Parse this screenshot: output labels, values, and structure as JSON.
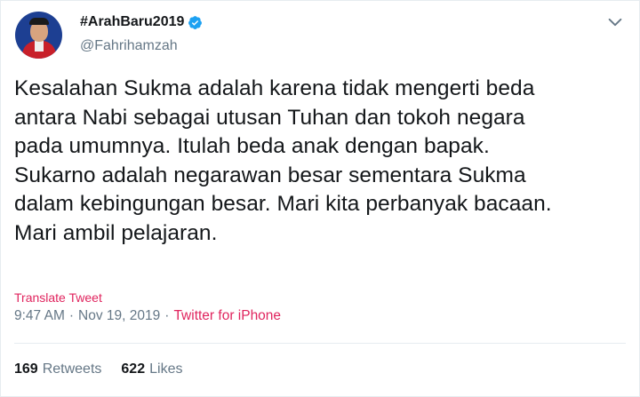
{
  "author": {
    "display_name": "#ArahBaru2019",
    "handle": "@Fahrihamzah",
    "verified": true
  },
  "tweet": {
    "text": "Kesalahan Sukma adalah karena tidak mengerti beda\nantara Nabi sebagai utusan Tuhan dan tokoh negara\npada umumnya. Itulah beda anak dengan bapak.\nSukarno adalah negarawan besar sementara Sukma\ndalam kebingungan besar. Mari kita perbanyak bacaan.\nMari ambil pelajaran."
  },
  "translate_label": "Translate Tweet",
  "meta": {
    "time": "9:47 AM",
    "separator": "·",
    "date": "Nov 19, 2019",
    "source": "Twitter for iPhone"
  },
  "stats": {
    "retweets_count": "169",
    "retweets_label": "Retweets",
    "likes_count": "622",
    "likes_label": "Likes"
  },
  "icons": {
    "verified": "verified-badge-icon",
    "menu": "chevron-down-icon"
  },
  "colors": {
    "accent": "#e0245e",
    "verified": "#1da1f2",
    "muted": "#657786",
    "text": "#14171a"
  }
}
